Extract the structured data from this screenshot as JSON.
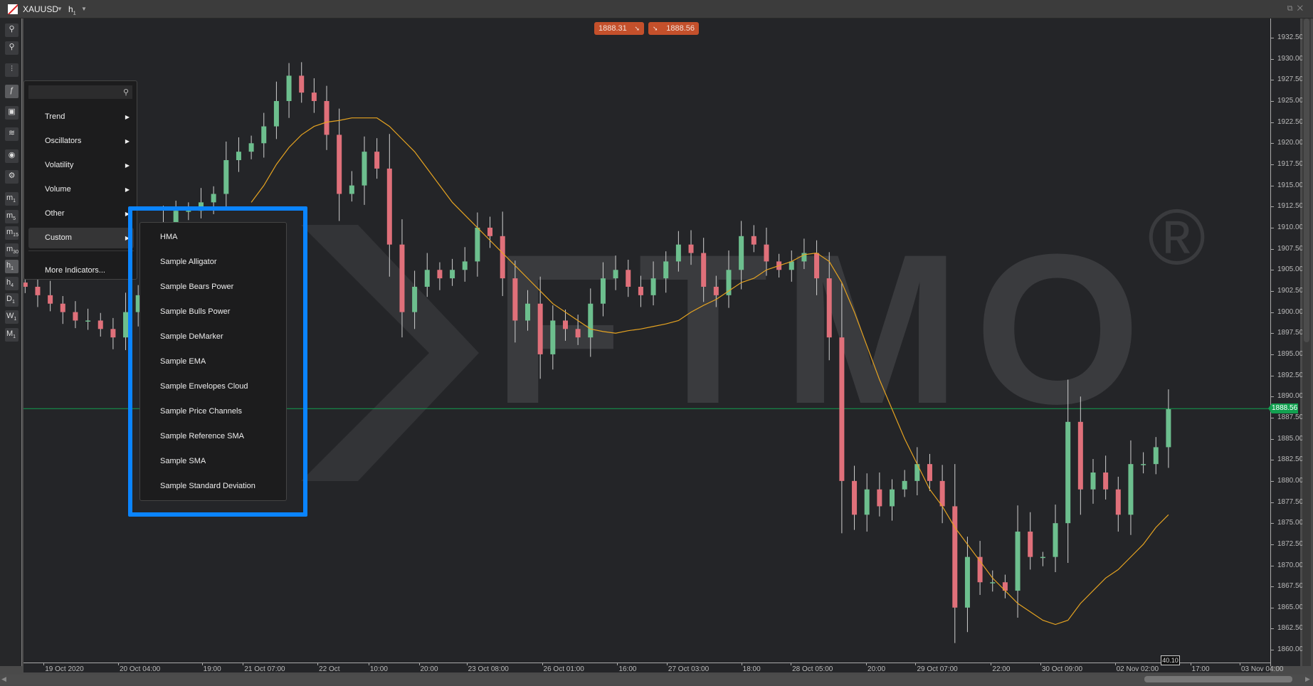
{
  "topbar": {
    "symbol": "XAUUSD",
    "timeframe": "h",
    "timeframe_sub": "1"
  },
  "quotes": {
    "bid": "1888.31",
    "ask": "1888.56",
    "current_price": "1888.56",
    "cursor_value": "40.10"
  },
  "colors": {
    "bull": "#6dbf8e",
    "bear": "#e0707a",
    "ma": "#e5a321",
    "price_line": "#12a050",
    "highlight": "#0a84ff",
    "bid_ask": "#c4502b"
  },
  "watermark": {
    "text": "FTMO",
    "registered": "®"
  },
  "toolbar": [
    {
      "icon": "zoom-in-icon"
    },
    {
      "icon": "zoom-out-icon"
    },
    {
      "icon": "candlestick-icon"
    },
    {
      "icon": "indicator-f-icon",
      "active": true
    },
    {
      "icon": "robot-icon"
    },
    {
      "icon": "layers-icon"
    },
    {
      "icon": "eye-icon"
    },
    {
      "icon": "chart-settings-icon"
    },
    {
      "label": "m",
      "sub": "1"
    },
    {
      "label": "m",
      "sub": "5"
    },
    {
      "label": "m",
      "sub": "15"
    },
    {
      "label": "m",
      "sub": "30"
    },
    {
      "label": "h",
      "sub": "1",
      "active": true
    },
    {
      "label": "h",
      "sub": "4"
    },
    {
      "label": "D",
      "sub": "1"
    },
    {
      "label": "W",
      "sub": "1"
    },
    {
      "label": "M",
      "sub": "1"
    }
  ],
  "menu": {
    "search_value": "",
    "items": [
      {
        "label": "Trend"
      },
      {
        "label": "Oscillators"
      },
      {
        "label": "Volatility"
      },
      {
        "label": "Volume"
      },
      {
        "label": "Other"
      },
      {
        "label": "Custom",
        "highlighted": true
      }
    ],
    "more": "More Indicators..."
  },
  "submenu": {
    "items": [
      "HMA",
      "Sample Alligator",
      "Sample Bears Power",
      "Sample Bulls Power",
      "Sample DeMarker",
      "Sample EMA",
      "Sample Envelopes Cloud",
      "Sample Price Channels",
      "Sample Reference SMA",
      "Sample SMA",
      "Sample Standard Deviation"
    ]
  },
  "chart_data": {
    "type": "candlestick",
    "ylim": [
      1860,
      1932.5
    ],
    "y_ticks": [
      "1932.50",
      "1930.00",
      "1927.50",
      "1925.00",
      "1922.50",
      "1920.00",
      "1917.50",
      "1915.00",
      "1912.50",
      "1910.00",
      "1907.50",
      "1905.00",
      "1902.50",
      "1900.00",
      "1897.50",
      "1895.00",
      "1892.50",
      "1890.00",
      "1887.50",
      "1885.00",
      "1882.50",
      "1880.00",
      "1877.50",
      "1875.00",
      "1872.50",
      "1870.00",
      "1867.50",
      "1865.00",
      "1862.50",
      "1860.00"
    ],
    "x_ticks": [
      "19 Oct 2020",
      "20 Oct 04:00",
      "19:00",
      "21 Oct 07:00",
      "22 Oct",
      "10:00",
      "20:00",
      "23 Oct 08:00",
      "26 Oct 01:00",
      "16:00",
      "27 Oct 03:00",
      "18:00",
      "28 Oct 05:00",
      "20:00",
      "29 Oct 07:00",
      "22:00",
      "30 Oct 09:00",
      "02 Nov 02:00",
      "17:00",
      "03 Nov 04:00"
    ],
    "closes": [
      1903,
      1902,
      1901,
      1900,
      1899,
      1899,
      1898,
      1897,
      1900,
      1902,
      1906,
      1910,
      1912,
      1912,
      1913,
      1914,
      1918,
      1919,
      1920,
      1922,
      1925,
      1928,
      1926,
      1925,
      1921,
      1914,
      1915,
      1919,
      1917,
      1908,
      1900,
      1903,
      1905,
      1904,
      1905,
      1906,
      1910,
      1909,
      1904,
      1899,
      1901,
      1895,
      1899,
      1898,
      1897,
      1901,
      1904,
      1905,
      1903,
      1902,
      1904,
      1906,
      1908,
      1907,
      1903,
      1902,
      1905,
      1909,
      1908,
      1906,
      1905,
      1906,
      1907,
      1904,
      1897,
      1880,
      1876,
      1879,
      1877,
      1879,
      1880,
      1882,
      1880,
      1877,
      1865,
      1871,
      1868,
      1868,
      1867,
      1874,
      1871,
      1871,
      1875,
      1887,
      1879,
      1881,
      1879,
      1876,
      1882,
      1882,
      1884,
      1888.5
    ],
    "moving_average": [
      null,
      null,
      null,
      null,
      null,
      null,
      null,
      null,
      null,
      null,
      null,
      null,
      null,
      null,
      null,
      null,
      null,
      null,
      1913,
      1915,
      1917.5,
      1919.5,
      1921,
      1922,
      1922.5,
      1922.7,
      1923,
      1923,
      1923,
      1922,
      1920.5,
      1919,
      1917,
      1915,
      1913,
      1911.5,
      1910,
      1908.5,
      1907,
      1905.5,
      1904,
      1902.5,
      1901,
      1900,
      1899,
      1898,
      1897.7,
      1897.5,
      1897.8,
      1898,
      1898.3,
      1898.6,
      1899,
      1900,
      1900.8,
      1901.5,
      1902.5,
      1903.5,
      1904,
      1905,
      1905.5,
      1906,
      1906.8,
      1907,
      1906,
      1903.5,
      1900,
      1896,
      1892,
      1888.5,
      1885,
      1882,
      1879,
      1877,
      1874.5,
      1872.5,
      1870.5,
      1868.5,
      1867,
      1865.5,
      1864.5,
      1863.5,
      1863,
      1863.5,
      1865.5,
      1867,
      1868.5,
      1869.5,
      1871,
      1872.5,
      1874.5,
      1876
    ],
    "current_price": 1888.56
  }
}
